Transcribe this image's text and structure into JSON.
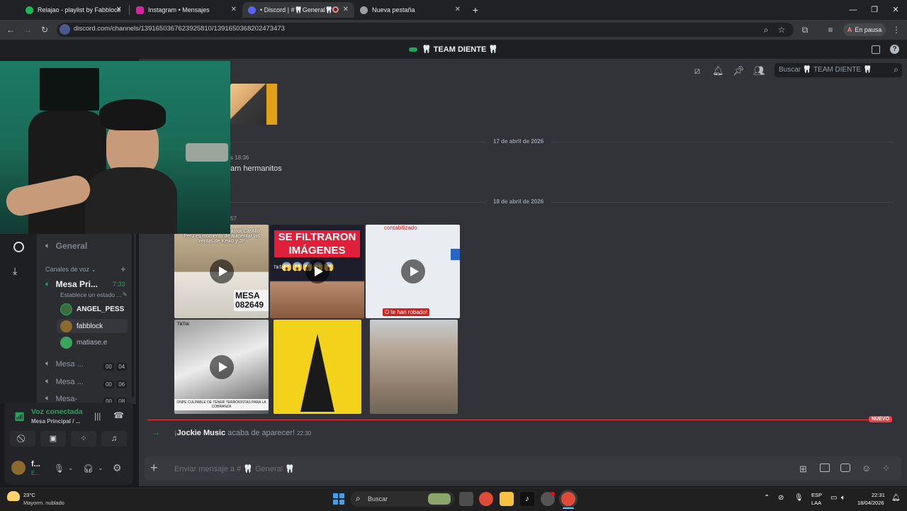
{
  "browser": {
    "tabs": [
      {
        "title": "Relajao - playlist by Fabblock",
        "favicon_color": "#1db954"
      },
      {
        "title": "Instagram • Mensajes",
        "favicon_color": "#d6249f"
      },
      {
        "title": "• Discord | #🦷General🦷",
        "favicon_color": "#5865f2"
      },
      {
        "title": "Nueva pestaña",
        "favicon_color": "#9aa0a6"
      }
    ],
    "url": "discord.com/channels/1391650367623925810/1391650368202473473",
    "profile_status": "En pausa",
    "profile_initial": "A"
  },
  "discord": {
    "server_name": "🦷 TEAM DIENTE 🦷",
    "search_placeholder": "Buscar 🦷 TEAM DIENTE 🦷",
    "top_channel": "General",
    "voice_section_label": "Canales de voz",
    "voice_channel": {
      "name": "Mesa Pri...",
      "time": "7:33",
      "status": "Establece un estado ..."
    },
    "voice_users": [
      {
        "name": "ANGEL_PESS",
        "avatar_color": "#3b6b3f"
      },
      {
        "name": "fabblock",
        "avatar_color": "#8a6a2e"
      },
      {
        "name": "matiase.e",
        "avatar_color": "#3ba55d"
      }
    ],
    "other_voice_channels": [
      {
        "name": "Mesa ...",
        "a": "00",
        "b": "04"
      },
      {
        "name": "Mesa ...",
        "a": "00",
        "b": "06"
      },
      {
        "name": "Mesa-",
        "a": "00",
        "b": "08"
      }
    ],
    "voice_connected": {
      "title": "Voz conectada",
      "subtitle": "Mesa Principal / ..."
    },
    "user_panel": {
      "name": "f...",
      "status": "E..."
    },
    "messages": {
      "date1": "17 de abril de 2026",
      "msg_time_partial": "s 18:36",
      "msg_text_partial": "am hermanitos",
      "date2": "18 de abril de 2026",
      "time_partial": "57",
      "media_texts": {
        "m1": "Como último acto de amor Castillo Perú es momento de aumentar las ventas de Keiko y JP",
        "m1_plate": "MESA 082649",
        "m2": "SE FILTRARON IMÁGENES",
        "m2_emoji": "😱😱😱😱😱",
        "m3_top": "contabilizado",
        "m3_label": "O te han robado!",
        "m4_caption": "ONPE CULPABLE DE TENER TERRORISTAS PARA LA COBRANZA",
        "tiktok": "TikTok"
      },
      "system_msg": {
        "name": "Jockie Music",
        "text": "acaba de aparecer!",
        "time": "22:30"
      },
      "new_label": "NUEVO"
    },
    "composer_placeholder": "Enviar mensaje a # 🦷 General 🦷"
  },
  "taskbar": {
    "weather_temp": "23°C",
    "weather_desc": "Mayorm. nublado",
    "search_label": "Buscar",
    "lang_top": "ESP",
    "lang_bottom": "LAA",
    "time": "22:31",
    "date": "18/04/2026"
  }
}
